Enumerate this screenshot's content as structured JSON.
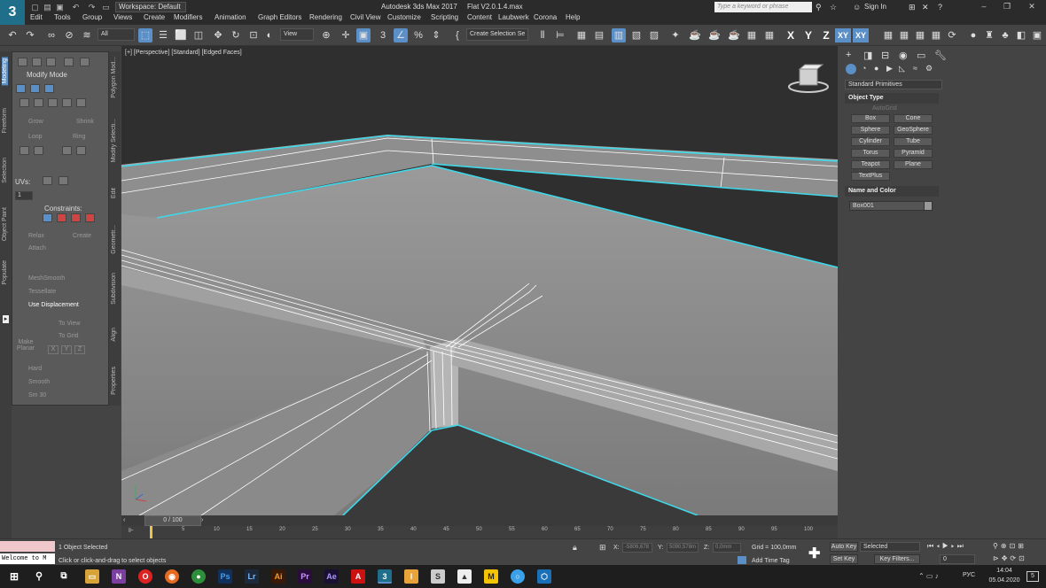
{
  "titlebar": {
    "logo": "3",
    "workspace": "Workspace: Default",
    "app_title": "Autodesk 3ds Max 2017",
    "file_title": "Flat V2.0.1.4.max",
    "search_placeholder": "Type a keyword or phrase",
    "sign_in": "Sign In"
  },
  "menu": [
    "Edit",
    "Tools",
    "Group",
    "Views",
    "Create",
    "Modifiers",
    "Animation",
    "Graph Editors",
    "Rendering",
    "Civil View",
    "Customize",
    "Scripting",
    "Content",
    "Laubwerk",
    "Corona",
    "Help"
  ],
  "toolbar": {
    "filter": "All",
    "refcoord": "View",
    "selection_set": "Create Selection Se",
    "axes": [
      "X",
      "Y",
      "Z",
      "XY",
      "XY"
    ]
  },
  "left_tabs": [
    "Modeling",
    "Freeform",
    "Selection",
    "Object Paint",
    "Populate"
  ],
  "ribbon": {
    "modify_mode": "Modify Mode",
    "grow": "Grow",
    "shrink": "Shrink",
    "loop": "Loop",
    "ring": "Ring",
    "uvs": "UVs:",
    "uv_value": "1",
    "constraints": "Constraints:",
    "relax": "Relax",
    "create": "Create",
    "attach": "Attach",
    "meshsmooth": "MeshSmooth",
    "tessellate": "Tessellate",
    "use_displacement": "Use Displacement",
    "to_view": "To View",
    "to_grid": "To Grid",
    "make_planar": "Make Planar",
    "axes": [
      "X",
      "Y",
      "Z"
    ],
    "hard": "Hard",
    "smooth": "Smooth",
    "smooth30": "Sm 30"
  },
  "ribbon_tabs": [
    "Polygon Mod...",
    "Modify Selecti...",
    "Edit",
    "Geometr...",
    "Subdivision",
    "Align",
    "Properties"
  ],
  "viewport": {
    "label": "[+] [Perspective] [Standard] [Edged Faces]"
  },
  "command_panel": {
    "category": "Standard Primitives",
    "object_type": "Object Type",
    "autogrid": "AutoGrid",
    "buttons": [
      "Box",
      "Cone",
      "Sphere",
      "GeoSphere",
      "Cylinder",
      "Tube",
      "Torus",
      "Pyramid",
      "Teapot",
      "Plane",
      "TextPlus"
    ],
    "name_and_color": "Name and Color",
    "object_name": "Box001"
  },
  "timeline": {
    "frame": "0 / 100",
    "ticks": [
      "5",
      "10",
      "15",
      "20",
      "25",
      "30",
      "35",
      "40",
      "45",
      "50",
      "55",
      "60",
      "65",
      "70",
      "75",
      "80",
      "85",
      "90",
      "95",
      "100"
    ],
    "track_start": "0"
  },
  "status": {
    "welcome": "Welcome to M",
    "selected": "1 Object Selected",
    "prompt": "Click or click-and-drag to select objects",
    "x_label": "X:",
    "x_value": "-5806,678",
    "y_label": "Y:",
    "y_value": "5090,578m",
    "z_label": "Z:",
    "z_value": "0,0mm",
    "grid": "Grid = 100,0mm",
    "add_time_tag": "Add Time Tag",
    "auto_key": "Auto Key",
    "set_key": "Set Key",
    "selected_drop": "Selected",
    "key_filters": "Key Filters...",
    "frame_value": "0"
  },
  "taskbar": {
    "time": "14:04",
    "date": "05.04.2020",
    "lang": "РУС",
    "notif": "5"
  },
  "colors": {
    "accent": "#5b8fc7",
    "selection_edge": "#3fd8e8",
    "logo": "#1f6f8b"
  }
}
